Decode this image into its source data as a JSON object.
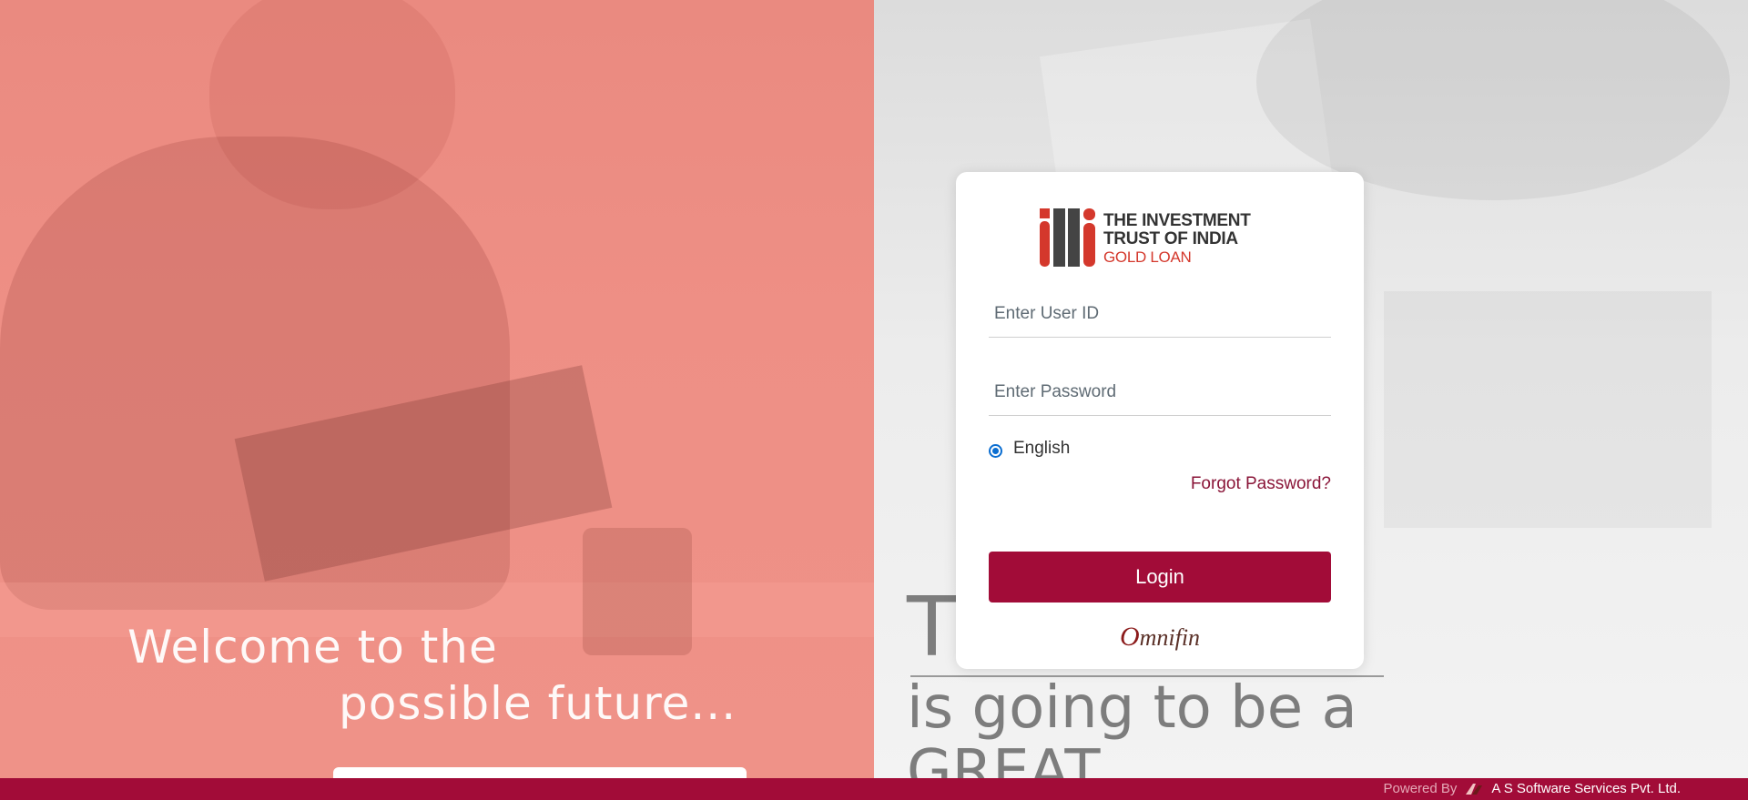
{
  "hero": {
    "welcome_line1": "Welcome to the",
    "welcome_line2": "possible future...",
    "tagline_t": "T",
    "tagline_line2": "is going to be a",
    "tagline_line3": "GREAT"
  },
  "login": {
    "logo": {
      "line1": "THE INVESTMENT",
      "line2": "TRUST OF INDIA",
      "line3": "GOLD LOAN"
    },
    "user_id_placeholder": "Enter User ID",
    "password_placeholder": "Enter Password",
    "language_option": "English",
    "language_selected": true,
    "forgot_password": "Forgot Password?",
    "login_button": "Login",
    "brand_o": "O",
    "brand_rest": "mnifin"
  },
  "footer": {
    "powered_by": "Powered By",
    "company": "A S Software Services Pvt. Ltd."
  },
  "colors": {
    "accent": "#a20c38",
    "hero_left": "#ee8f85",
    "link": "#8a1538",
    "radio": "#0b6ed1"
  }
}
